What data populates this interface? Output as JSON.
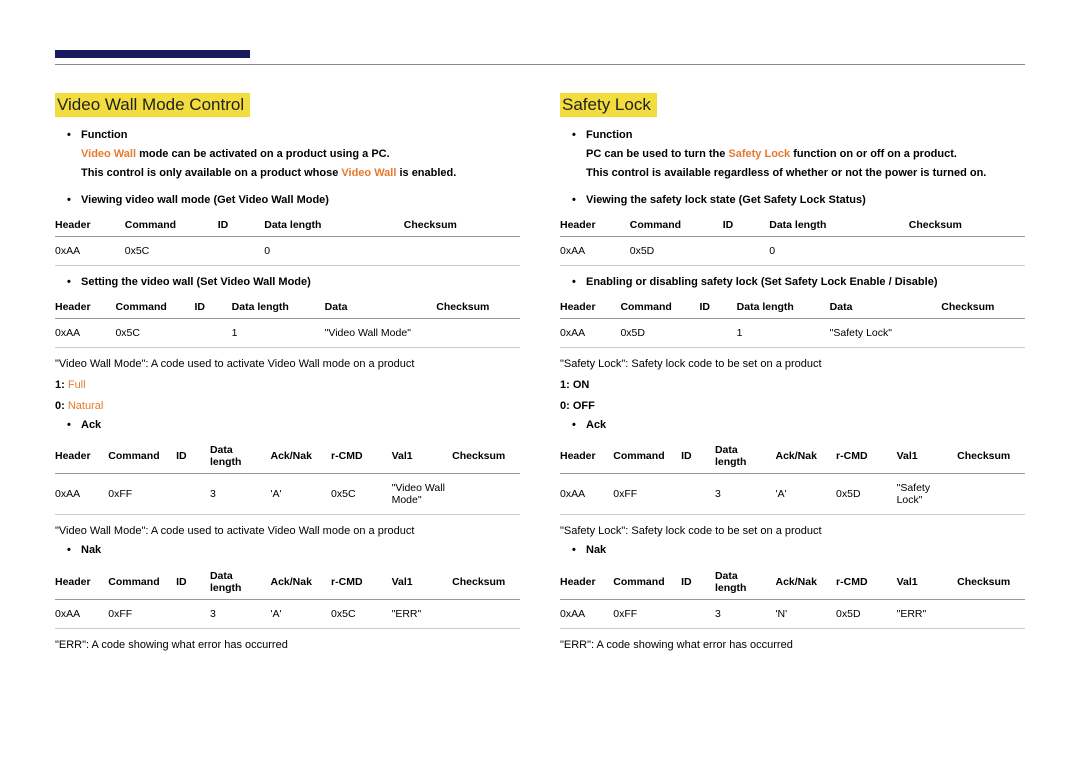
{
  "left": {
    "title": "Video Wall Mode Control",
    "function_label": "Function",
    "func_line1_pre": "Video Wall",
    "func_line1_post": " mode can be activated on a product using a PC.",
    "func_line2_pre": "This control is only available on a product whose ",
    "func_line2_orange": "Video Wall",
    "func_line2_post": " is enabled.",
    "view_label": "Viewing video wall mode (Get Video Wall Mode)",
    "t1": {
      "h": [
        "Header",
        "Command",
        "ID",
        "Data length",
        "Checksum"
      ],
      "r": [
        "0xAA",
        "0x5C",
        "",
        "0",
        ""
      ]
    },
    "set_label": "Setting the video wall (Set Video Wall Mode)",
    "t2": {
      "h": [
        "Header",
        "Command",
        "ID",
        "Data length",
        "Data",
        "Checksum"
      ],
      "r": [
        "0xAA",
        "0x5C",
        "",
        "1",
        "\"Video Wall Mode\"",
        ""
      ]
    },
    "desc1": "\"Video Wall Mode\": A code used to activate Video Wall mode on a product",
    "opt1_lbl": "1: ",
    "opt1_val": "Full",
    "opt0_lbl": "0: ",
    "opt0_val": "Natural",
    "ack_label": "Ack",
    "t3": {
      "h": [
        "Header",
        "Command",
        "ID",
        "Data length",
        "Ack/Nak",
        "r-CMD",
        "Val1",
        "Checksum"
      ],
      "r": [
        "0xAA",
        "0xFF",
        "",
        "3",
        "'A'",
        "0x5C",
        "\"Video Wall Mode\"",
        ""
      ]
    },
    "desc2": "\"Video Wall Mode\": A code used to activate Video Wall mode on a product",
    "nak_label": "Nak",
    "t4": {
      "h": [
        "Header",
        "Command",
        "ID",
        "Data length",
        "Ack/Nak",
        "r-CMD",
        "Val1",
        "Checksum"
      ],
      "r": [
        "0xAA",
        "0xFF",
        "",
        "3",
        "'A'",
        "0x5C",
        "\"ERR\"",
        ""
      ]
    },
    "err_desc": "\"ERR\": A code showing what error has occurred"
  },
  "right": {
    "title": "Safety Lock",
    "function_label": "Function",
    "func_line1_pre": "PC can be used to turn the ",
    "func_line1_orange": "Safety Lock",
    "func_line1_post": " function on or off on a product.",
    "func_line2": "This control is available regardless of whether or not the power is turned on.",
    "view_label": "Viewing the safety lock state (Get Safety Lock Status)",
    "t1": {
      "h": [
        "Header",
        "Command",
        "ID",
        "Data length",
        "Checksum"
      ],
      "r": [
        "0xAA",
        "0x5D",
        "",
        "0",
        ""
      ]
    },
    "set_label": "Enabling or disabling safety lock (Set Safety Lock Enable / Disable)",
    "t2": {
      "h": [
        "Header",
        "Command",
        "ID",
        "Data length",
        "Data",
        "Checksum"
      ],
      "r": [
        "0xAA",
        "0x5D",
        "",
        "1",
        "\"Safety Lock\"",
        ""
      ]
    },
    "desc1": "\"Safety Lock\": Safety lock code to be set on a product",
    "opt1": "1: ON",
    "opt0": "0: OFF",
    "ack_label": "Ack",
    "t3": {
      "h": [
        "Header",
        "Command",
        "ID",
        "Data length",
        "Ack/Nak",
        "r-CMD",
        "Val1",
        "Checksum"
      ],
      "r": [
        "0xAA",
        "0xFF",
        "",
        "3",
        "'A'",
        "0x5D",
        "\"Safety Lock\"",
        ""
      ]
    },
    "desc2": "\"Safety Lock\": Safety lock code to be set on a product",
    "nak_label": "Nak",
    "t4": {
      "h": [
        "Header",
        "Command",
        "ID",
        "Data length",
        "Ack/Nak",
        "r-CMD",
        "Val1",
        "Checksum"
      ],
      "r": [
        "0xAA",
        "0xFF",
        "",
        "3",
        "'N'",
        "0x5D",
        "\"ERR\"",
        ""
      ]
    },
    "err_desc": "\"ERR\": A code showing what error has occurred"
  }
}
